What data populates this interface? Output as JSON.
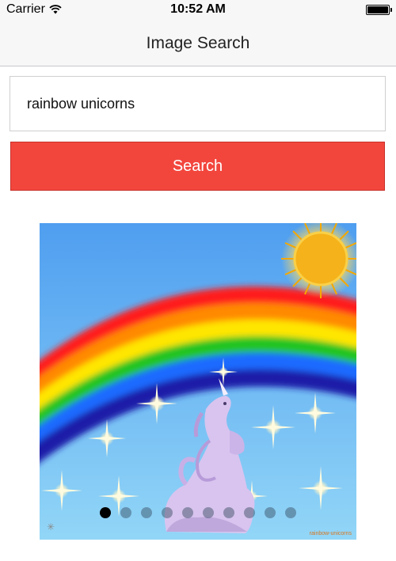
{
  "status_bar": {
    "carrier": "Carrier",
    "time": "10:52 AM",
    "battery_level": 1.0
  },
  "nav": {
    "title": "Image Search"
  },
  "search": {
    "value": "rainbow unicorns",
    "button_label": "Search"
  },
  "carousel": {
    "page_count": 10,
    "current_page": 1,
    "watermark": "rainbow-unicorns",
    "colors": {
      "sky_top": "#5aa6ee",
      "sky_bottom": "#8ed2f5",
      "sun": "#f5b21a"
    }
  },
  "colors": {
    "search_button": "#f2463d",
    "nav_background": "#f7f7f7"
  },
  "icons": [
    "wifi-icon",
    "battery-icon",
    "sun-icon",
    "sparkle-icon"
  ]
}
